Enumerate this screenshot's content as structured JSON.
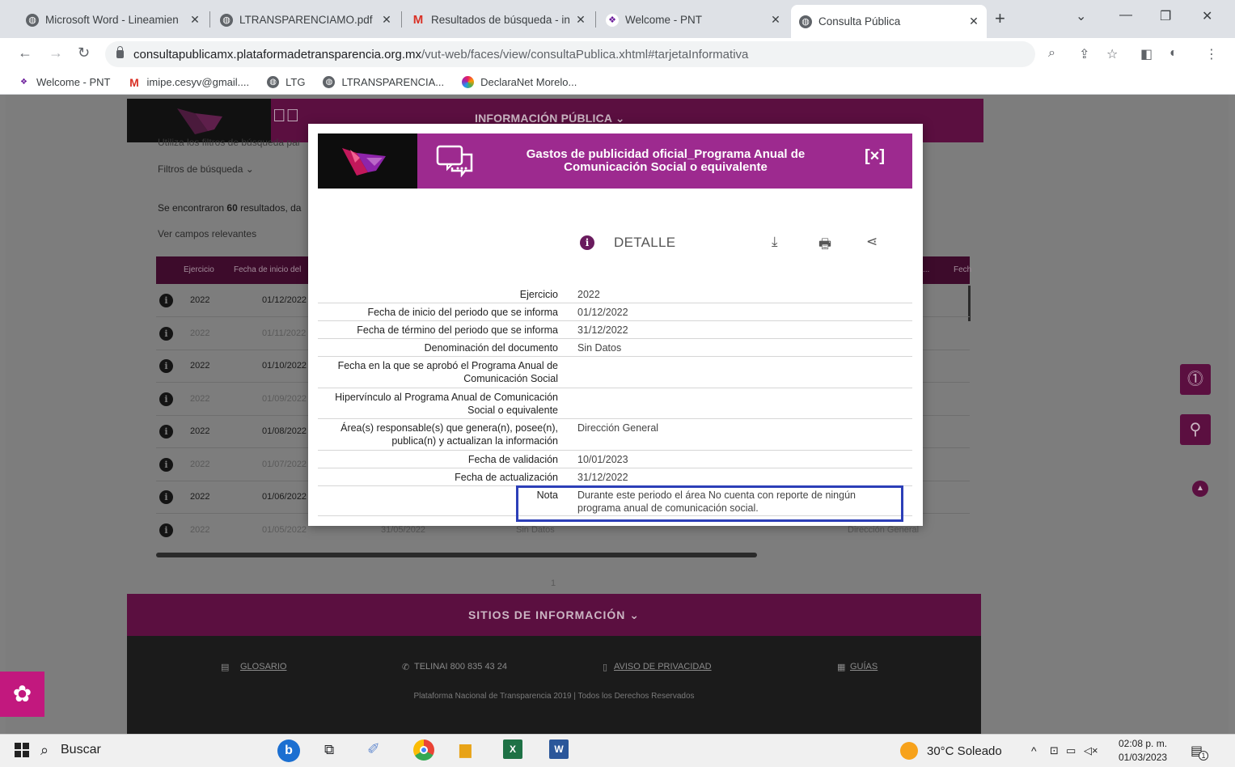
{
  "browser": {
    "tabs": [
      {
        "title": "Microsoft Word - Lineamien",
        "icon": "globe-icon"
      },
      {
        "title": "LTRANSPARENCIAMO.pdf",
        "icon": "globe-icon"
      },
      {
        "title": "Resultados de búsqueda - in",
        "icon": "gmail-icon"
      },
      {
        "title": "Welcome - PNT",
        "icon": "pnt-icon"
      },
      {
        "title": "Consulta Pública",
        "icon": "globe-icon",
        "active": true
      }
    ],
    "url_host": "consultapublicamx.plataformadetransparencia.org.mx",
    "url_path": "/vut-web/faces/view/consultaPublica.xhtml#tarjetaInformativa",
    "bookmarks": [
      "Welcome - PNT",
      "imipe.cesyv@gmail....",
      "LTG",
      "LTRANSPARENCIA...",
      "DeclaraNet Morelo..."
    ]
  },
  "site": {
    "menu": "INFORMACIÓN PÚBLICA ⌄",
    "filters_hint": "Utiliza los filtros de búsqueda par",
    "filters": "Filtros de búsqueda ⌄",
    "results_prefix": "Se encontraron ",
    "results_count": "60",
    "results_suffix": " resultados, da",
    "relevant_fields": "Ver campos relevantes",
    "table_headers": [
      "Ejercicio",
      "Fecha de inicio del",
      "...",
      "Fech"
    ],
    "rows": [
      {
        "year": "2022",
        "start": "01/12/2022"
      },
      {
        "year": "2022",
        "start": "01/11/2022"
      },
      {
        "year": "2022",
        "start": "01/10/2022"
      },
      {
        "year": "2022",
        "start": "01/09/2022"
      },
      {
        "year": "2022",
        "start": "01/08/2022"
      },
      {
        "year": "2022",
        "start": "01/07/2022"
      },
      {
        "year": "2022",
        "start": "01/06/2022"
      },
      {
        "year": "2022",
        "start": "01/05/2022",
        "end": "31/05/2022",
        "doc": "Sin Datos",
        "area": "Dirección General"
      }
    ],
    "page_number": "1",
    "sitios": "SITIOS DE INFORMACIÓN ⌄",
    "footer": {
      "glosario": "GLOSARIO",
      "telinai": "TELINAI 800 835 43 24",
      "aviso": "AVISO DE PRIVACIDAD",
      "guias": "GUÍAS",
      "copyright": "Plataforma Nacional de Transparencia 2019 | Todos los Derechos Reservados"
    }
  },
  "modal": {
    "title_line1": "Gastos de publicidad oficial_Programa Anual de",
    "title_line2": "Comunicación Social o equivalente",
    "close": "[×]",
    "section": "DETALLE",
    "fields": [
      {
        "label": "Ejercicio",
        "value": "2022"
      },
      {
        "label": "Fecha de inicio del periodo que se informa",
        "value": "01/12/2022"
      },
      {
        "label": "Fecha de término del periodo que se informa",
        "value": "31/12/2022"
      },
      {
        "label": "Denominación del documento",
        "value": "Sin Datos"
      },
      {
        "label": "Fecha en la que se aprobó el Programa Anual de Comunicación Social",
        "value": ""
      },
      {
        "label": "Hipervínculo al Programa Anual de Comunicación Social o equivalente",
        "value": ""
      },
      {
        "label": "Área(s) responsable(s) que genera(n), posee(n), publica(n) y actualizan la información",
        "value": "Dirección General"
      },
      {
        "label": "Fecha de validación",
        "value": "10/01/2023"
      },
      {
        "label": "Fecha de actualización",
        "value": "31/12/2022"
      },
      {
        "label": "Nota",
        "value": "Durante este periodo el área No cuenta con reporte de ningún programa anual de comunicación social."
      }
    ]
  },
  "taskbar": {
    "search": "Buscar",
    "weather": "30°C Soleado",
    "time": "02:08 p. m.",
    "date": "01/03/2023",
    "notifications": "1"
  },
  "colors": {
    "brand": "#9d2a8f",
    "brand_dark": "#5b0f40",
    "highlight": "#2c3fb8"
  }
}
